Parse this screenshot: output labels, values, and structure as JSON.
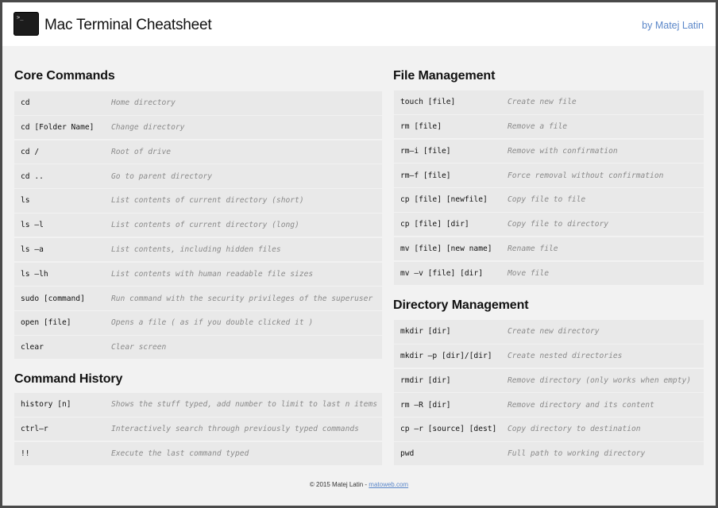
{
  "header": {
    "logo_text": ">_",
    "title": "Mac Terminal Cheatsheet",
    "byline": "by Matej Latin"
  },
  "sections": {
    "core": {
      "title": "Core Commands",
      "rows": [
        {
          "cmd": "cd",
          "desc": "Home directory"
        },
        {
          "cmd": "cd [Folder Name]",
          "desc": "Change directory"
        },
        {
          "cmd": "cd /",
          "desc": "Root of drive"
        },
        {
          "cmd": "cd ..",
          "desc": "Go to parent directory"
        },
        {
          "cmd": "ls",
          "desc": "List contents of current directory (short)"
        },
        {
          "cmd": "ls –l",
          "desc": "List contents of current directory (long)"
        },
        {
          "cmd": "ls –a",
          "desc": "List contents, including hidden files"
        },
        {
          "cmd": "ls –lh",
          "desc": "List contents with human readable file sizes"
        },
        {
          "cmd": "sudo [command]",
          "desc": "Run command with the security privileges of the superuser"
        },
        {
          "cmd": "open [file]",
          "desc": "Opens a file ( as if you double clicked it )"
        },
        {
          "cmd": "clear",
          "desc": "Clear screen"
        }
      ]
    },
    "history": {
      "title": "Command History",
      "rows": [
        {
          "cmd": "history [n]",
          "desc": "Shows the stuff typed, add number to limit to last n items"
        },
        {
          "cmd": "ctrl–r",
          "desc": "Interactively search through previously typed commands"
        },
        {
          "cmd": "!!",
          "desc": "Execute the last command typed"
        }
      ]
    },
    "files": {
      "title": "File Management",
      "rows": [
        {
          "cmd": "touch [file]",
          "desc": "Create new file"
        },
        {
          "cmd": "rm [file]",
          "desc": "Remove a file"
        },
        {
          "cmd": "rm–i [file]",
          "desc": "Remove with confirmation"
        },
        {
          "cmd": "rm–f [file]",
          "desc": "Force removal without confirmation"
        },
        {
          "cmd": "cp [file] [newfile]",
          "desc": "Copy file to file"
        },
        {
          "cmd": "cp [file] [dir]",
          "desc": "Copy file to directory"
        },
        {
          "cmd": "mv [file] [new name]",
          "desc": "Rename file"
        },
        {
          "cmd": "mv –v [file] [dir]",
          "desc": "Move file"
        }
      ]
    },
    "dirs": {
      "title": "Directory Management",
      "rows": [
        {
          "cmd": "mkdir [dir]",
          "desc": "Create new directory"
        },
        {
          "cmd": "mkdir –p [dir]/[dir]",
          "desc": "Create nested directories"
        },
        {
          "cmd": "rmdir [dir]",
          "desc": "Remove directory (only works when empty)"
        },
        {
          "cmd": "rm –R [dir]",
          "desc": "Remove directory and its content"
        },
        {
          "cmd": "cp –r [source] [dest]",
          "desc": "Copy directory to destination"
        },
        {
          "cmd": "pwd",
          "desc": "Full path to working directory"
        }
      ]
    }
  },
  "footer": {
    "copyright": "© 2015 Matej Latin - ",
    "link": "matoweb.com"
  }
}
